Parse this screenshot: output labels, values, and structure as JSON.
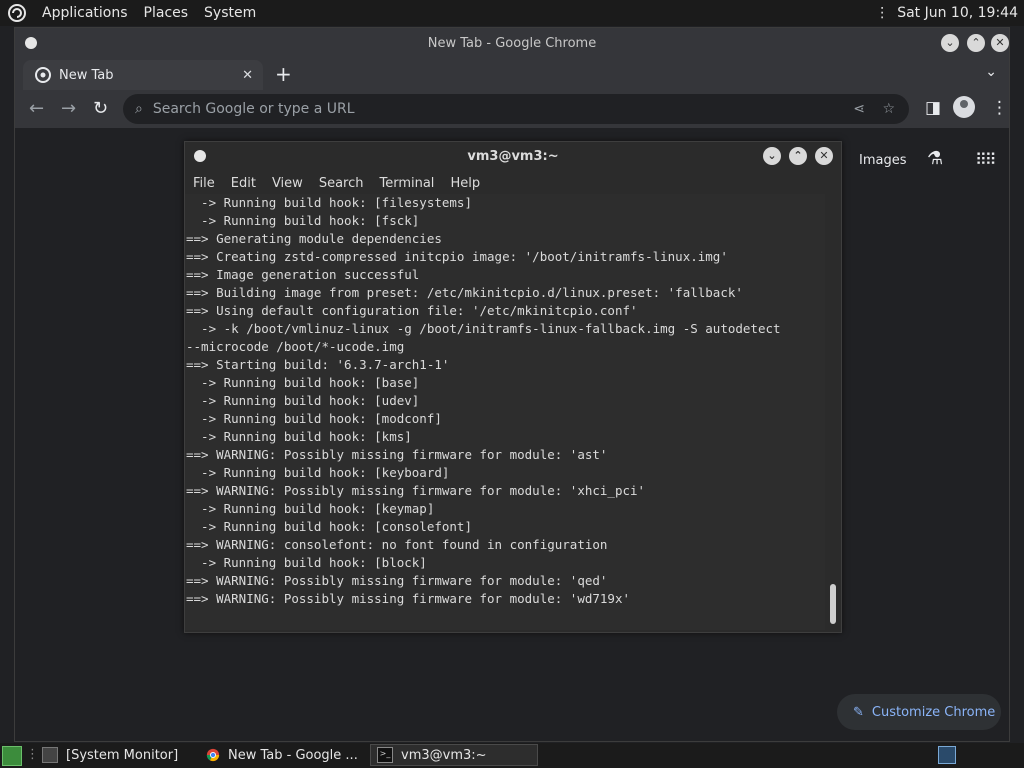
{
  "top_panel": {
    "menu": [
      "Applications",
      "Places",
      "System"
    ],
    "clock": "Sat Jun 10, 19:44"
  },
  "chrome": {
    "window_title": "New Tab - Google Chrome",
    "tab_title": "New Tab",
    "omnibox_placeholder": "Search Google or type a URL",
    "images_link": "Images",
    "customize_label": "Customize Chrome"
  },
  "terminal": {
    "title": "vm3@vm3:~",
    "menu": [
      "File",
      "Edit",
      "View",
      "Search",
      "Terminal",
      "Help"
    ],
    "lines": [
      "  -> Running build hook: [filesystems]",
      "  -> Running build hook: [fsck]",
      "==> Generating module dependencies",
      "==> Creating zstd-compressed initcpio image: '/boot/initramfs-linux.img'",
      "==> Image generation successful",
      "==> Building image from preset: /etc/mkinitcpio.d/linux.preset: 'fallback'",
      "==> Using default configuration file: '/etc/mkinitcpio.conf'",
      "  -> -k /boot/vmlinuz-linux -g /boot/initramfs-linux-fallback.img -S autodetect",
      "--microcode /boot/*-ucode.img",
      "==> Starting build: '6.3.7-arch1-1'",
      "  -> Running build hook: [base]",
      "  -> Running build hook: [udev]",
      "  -> Running build hook: [modconf]",
      "  -> Running build hook: [kms]",
      "==> WARNING: Possibly missing firmware for module: 'ast'",
      "  -> Running build hook: [keyboard]",
      "==> WARNING: Possibly missing firmware for module: 'xhci_pci'",
      "  -> Running build hook: [keymap]",
      "  -> Running build hook: [consolefont]",
      "==> WARNING: consolefont: no font found in configuration",
      "  -> Running build hook: [block]",
      "==> WARNING: Possibly missing firmware for module: 'qed'",
      "==> WARNING: Possibly missing firmware for module: 'wd719x'"
    ]
  },
  "taskbar": {
    "items": [
      "[System Monitor]",
      "New Tab - Google ...",
      "vm3@vm3:~"
    ]
  },
  "colors": {
    "accent_blue": "#8ab4f8",
    "panel_bg": "#1b1b1b",
    "terminal_bg": "#2d2d2d"
  }
}
